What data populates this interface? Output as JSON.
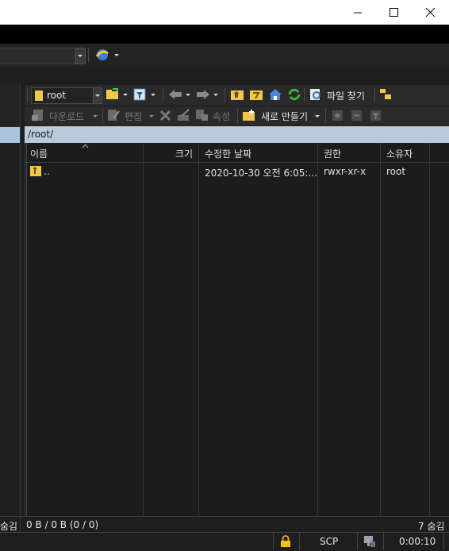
{
  "window": {
    "buttons": {
      "minimize": "minimize-icon",
      "maximize": "maximize-icon",
      "close": "close-icon"
    }
  },
  "session_toolbar": {
    "session_icon": "globe-session-icon"
  },
  "remote_toolbar": {
    "directory": "root",
    "find_files_label": "파일 찾기",
    "download_label": "다운로드",
    "edit_label": "편집",
    "properties_label": "속성",
    "new_label": "새로 만들기"
  },
  "path": "/root/",
  "columns": {
    "name": "이름",
    "size": "크기",
    "modified": "수정한 날짜",
    "rights": "권한",
    "owner": "소유자"
  },
  "files": [
    {
      "name": "..",
      "size": "",
      "modified": "2020-10-30 오전 6:05:...",
      "rights": "rwxr-xr-x",
      "owner": "root"
    }
  ],
  "status": {
    "left_hidden": "숨김",
    "selection": "0 B / 0 B (0 / 0)",
    "hidden_count": "7 숨김"
  },
  "bottom": {
    "protocol": "SCP",
    "elapsed": "0:00:10"
  },
  "colors": {
    "path_bar": "#b9cadb",
    "panel_bg": "#1c1c1c",
    "toolbar_bg": "#2a2a2a"
  }
}
